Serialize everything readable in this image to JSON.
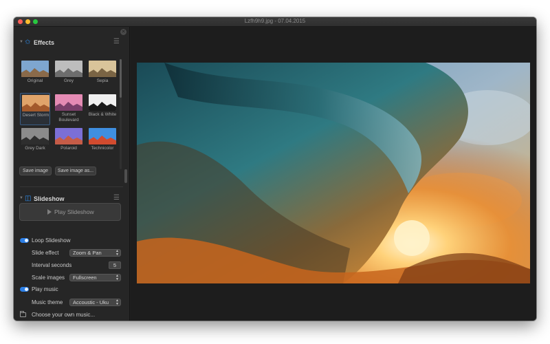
{
  "window": {
    "title": "Lzfh9h9.jpg - 07.04.2015"
  },
  "effects": {
    "title": "Effects",
    "items": [
      {
        "label": "Original",
        "colors": {
          "sky": "#7ea6cf",
          "mtn": "#8a6a4a"
        }
      },
      {
        "label": "Grey",
        "colors": {
          "sky": "#bdbdbd",
          "mtn": "#6d6d6d"
        }
      },
      {
        "label": "Sepia",
        "colors": {
          "sky": "#d9c49a",
          "mtn": "#7a6444"
        }
      },
      {
        "label": "Desert Storm",
        "colors": {
          "sky": "#e0a46a",
          "mtn": "#a35a2c"
        }
      },
      {
        "label": "Sunset Boulevard",
        "colors": {
          "sky": "#e58bb4",
          "mtn": "#7a3f6a"
        }
      },
      {
        "label": "Black & White",
        "colors": {
          "sky": "#f0f0f0",
          "mtn": "#1a1a1a"
        }
      },
      {
        "label": "Grey Dark",
        "colors": {
          "sky": "#8b8b8b",
          "mtn": "#2e2e2e"
        }
      },
      {
        "label": "Polaroid",
        "colors": {
          "sky": "#7b6fd6",
          "mtn": "#c55c47"
        }
      },
      {
        "label": "Technicolor",
        "colors": {
          "sky": "#3f8fe0",
          "mtn": "#d24b2f"
        }
      }
    ],
    "save_image": "Save image",
    "save_image_as": "Save image as..."
  },
  "slideshow": {
    "title": "Slideshow",
    "play_label": "Play Slideshow",
    "loop_label": "Loop Slideshow",
    "slide_effect_label": "Slide effect",
    "slide_effect_value": "Zoom & Pan",
    "interval_label": "Interval seconds",
    "interval_value": "5",
    "scale_label": "Scale images",
    "scale_value": "Fullscreen",
    "play_music_label": "Play music",
    "music_theme_label": "Music theme",
    "music_theme_value": "Accoustic - Uku",
    "choose_music_label": "Choose your own music..."
  },
  "colors": {
    "accent": "#2c7fe6"
  }
}
